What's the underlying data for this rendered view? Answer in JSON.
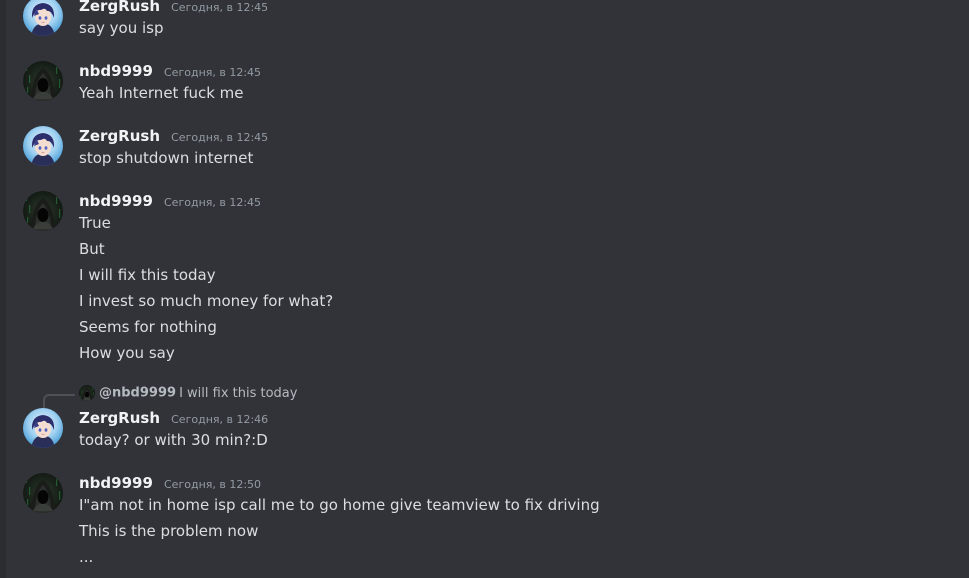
{
  "users": {
    "zerg": {
      "name": "ZergRush"
    },
    "nbd": {
      "name": "nbd9999"
    }
  },
  "messages": [
    {
      "author": "ZergRush",
      "time": "Сегодня, в 12:45",
      "lines": [
        "say you isp"
      ]
    },
    {
      "author": "nbd9999",
      "time": "Сегодня, в 12:45",
      "lines": [
        "Yeah Internet fuck me"
      ]
    },
    {
      "author": "ZergRush",
      "time": "Сегодня, в 12:45",
      "lines": [
        "stop shutdown internet"
      ]
    },
    {
      "author": "nbd9999",
      "time": "Сегодня, в 12:45",
      "lines": [
        "True",
        "But",
        "I will fix this today",
        "I invest so much money for what?",
        "Seems for nothing",
        "How you say"
      ]
    },
    {
      "author": "ZergRush",
      "time": "Сегодня, в 12:46",
      "reply": {
        "mention": "@nbd9999",
        "text": "I will fix this today"
      },
      "lines": [
        "today? or with 30 min?:D"
      ]
    },
    {
      "author": "nbd9999",
      "time": "Сегодня, в 12:50",
      "lines": [
        "I\"am not in home isp call me to go home give teamview to fix driving",
        "This is the problem now",
        "..."
      ]
    }
  ],
  "colors": {
    "background": "#313338",
    "username": "#f2f3f5",
    "timestamp": "#949ba4",
    "message_text": "#dbdee1"
  },
  "icons": {
    "zerg_avatar": "anime-character-avatar",
    "nbd_avatar": "hooded-figure-avatar"
  }
}
